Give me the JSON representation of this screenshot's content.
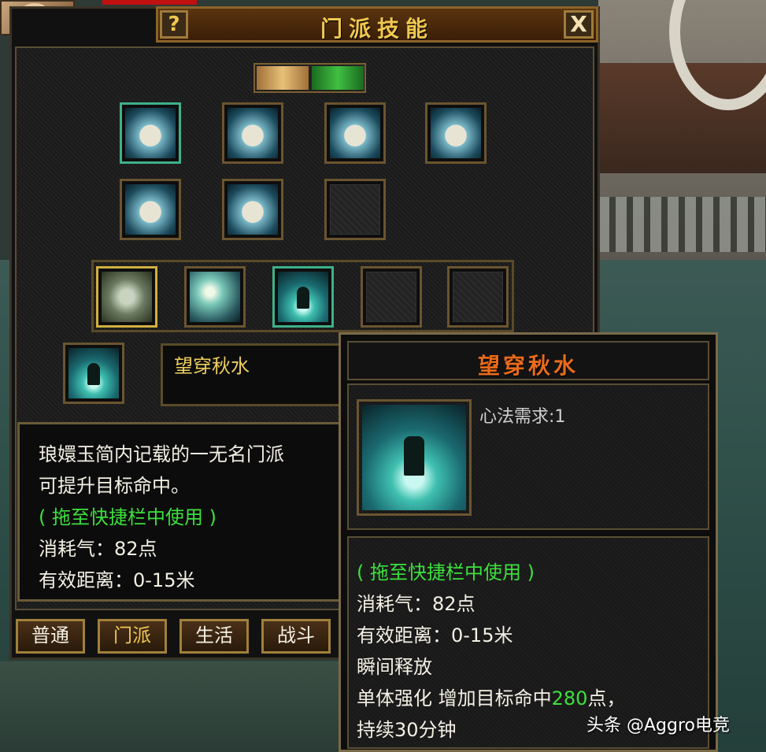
{
  "window": {
    "title": "门派技能",
    "help_label": "?",
    "close_label": "X"
  },
  "selected_skill": {
    "name": "望穿秋水"
  },
  "description": {
    "line1": "琅嬛玉简内记载的一无名门派",
    "line2": "可提升目标命中。",
    "hint": "( 拖至快捷栏中使用 )",
    "cost": "消耗气：82点",
    "range": "有效距离：0-15米"
  },
  "tabs": [
    "普通",
    "门派",
    "生活",
    "战斗"
  ],
  "active_tab": "门派",
  "tooltip": {
    "title": "望穿秋水",
    "requirement": "心法需求:1",
    "hint": "( 拖至快捷栏中使用 )",
    "cost": "消耗气：82点",
    "range": "有效距离：0-15米",
    "cast": "瞬间释放",
    "effect_prefix": "单体强化  增加目标命中",
    "effect_value": "280",
    "effect_suffix": "点，",
    "duration": "持续30分钟"
  },
  "watermark": "头条 @Aggro电竞",
  "icons": {
    "paw": "paw-icon",
    "books": [
      "open-book-icon",
      "scripture-icon",
      "scroll-book-icon",
      "scroll-icon",
      "manual-icon",
      "stacked-books-icon"
    ],
    "skills": [
      "staff-skill-icon",
      "fan-skill-icon",
      "meditation-skill-icon"
    ]
  },
  "colors": {
    "title_gold": "#f0c850",
    "tooltip_title": "#e86a1a",
    "hint_green": "#3ce03c",
    "name_yellow": "#f0d060"
  }
}
